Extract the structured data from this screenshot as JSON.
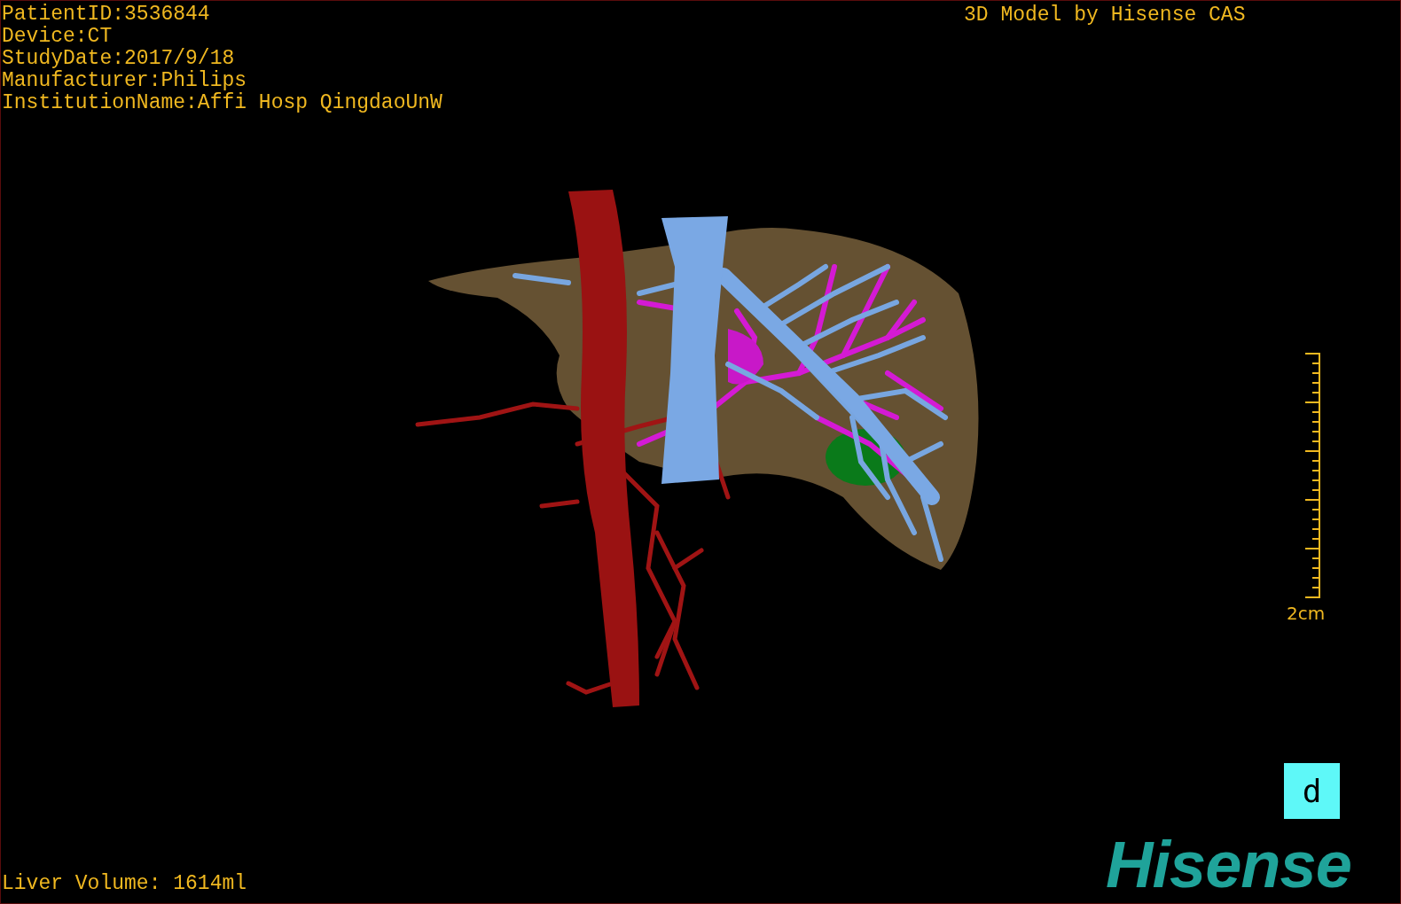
{
  "patient_info": [
    "PatientID:3536844",
    "Device:CT",
    "StudyDate:2017/9/18",
    "Manufacturer:Philips",
    "InstitutionName:Affi Hosp QingdaoUnW"
  ],
  "caption": "3D Model by Hisense CAS",
  "scale_bar": {
    "label": "2cm"
  },
  "orientation_cube": {
    "label": "d"
  },
  "logo": "Hisense",
  "liver_volume": "Liver Volume: 1614ml"
}
